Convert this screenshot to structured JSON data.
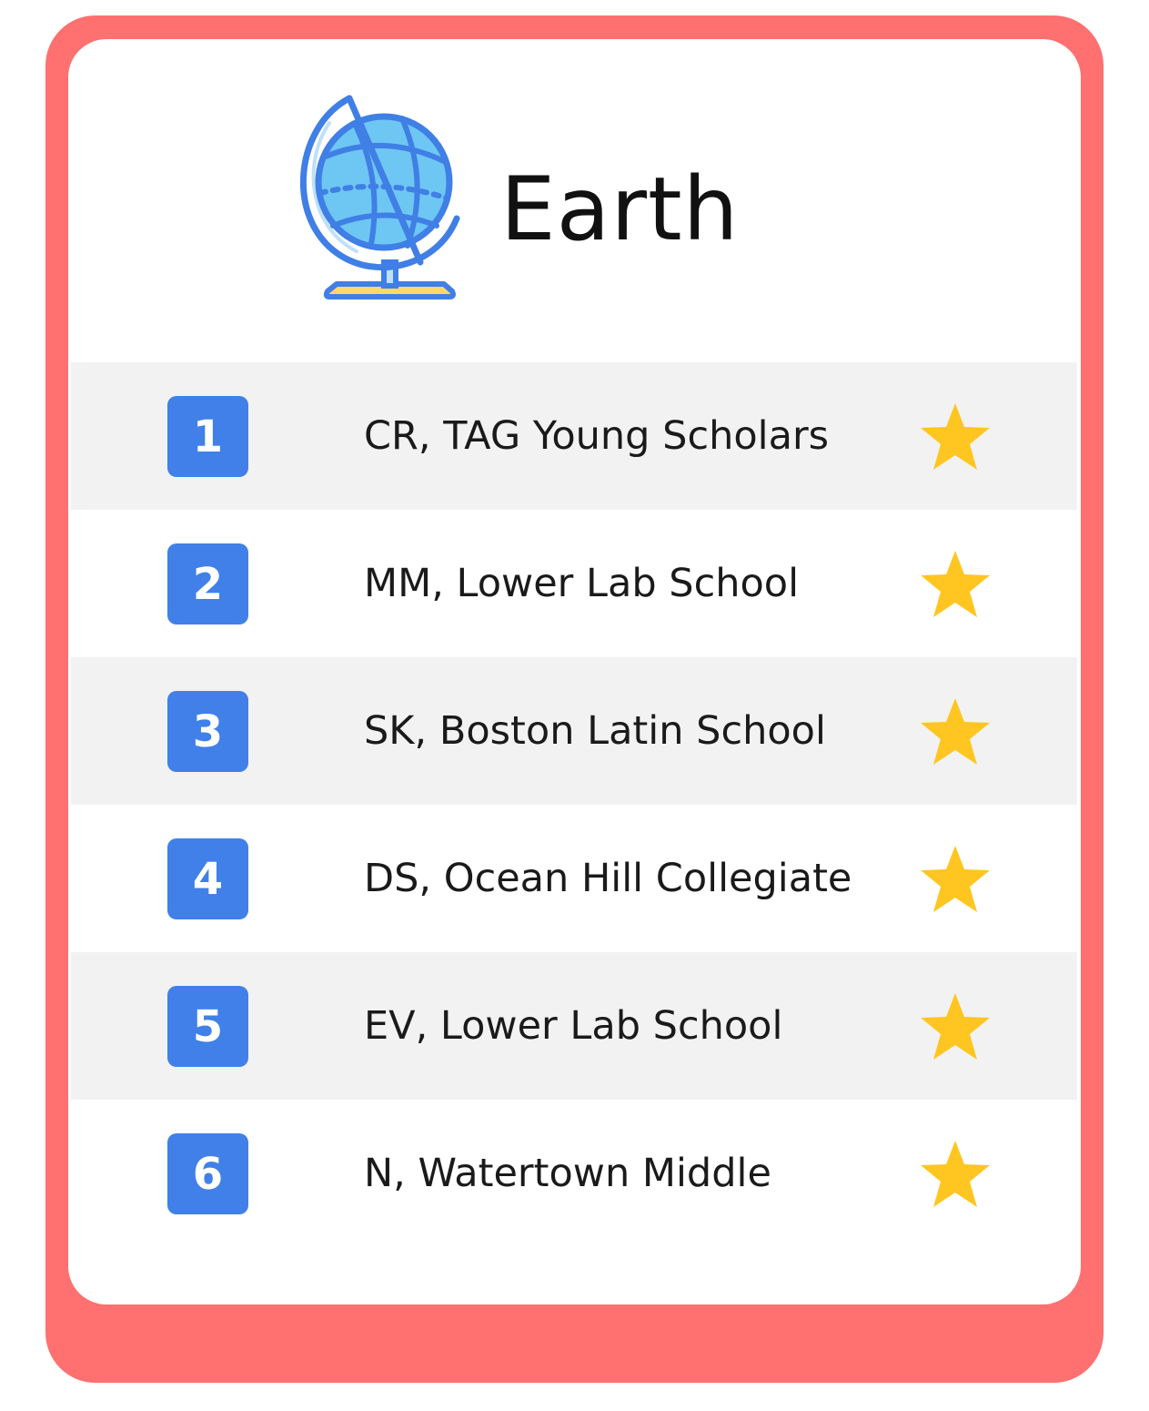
{
  "card": {
    "title": "Earth",
    "icon": "globe-icon",
    "colors": {
      "frame": "#ff7070",
      "badge": "#4080e8",
      "star": "#ffc521",
      "row_shade": "#f2f2f2"
    }
  },
  "entries": [
    {
      "rank": "1",
      "name": "CR, TAG Young Scholars",
      "icon": "star-icon"
    },
    {
      "rank": "2",
      "name": "MM, Lower Lab School",
      "icon": "star-icon"
    },
    {
      "rank": "3",
      "name": "SK, Boston Latin School",
      "icon": "star-icon"
    },
    {
      "rank": "4",
      "name": "DS, Ocean Hill Collegiate",
      "icon": "star-icon"
    },
    {
      "rank": "5",
      "name": "EV, Lower Lab School",
      "icon": "star-icon"
    },
    {
      "rank": "6",
      "name": "N, Watertown Middle",
      "icon": "star-icon"
    }
  ]
}
